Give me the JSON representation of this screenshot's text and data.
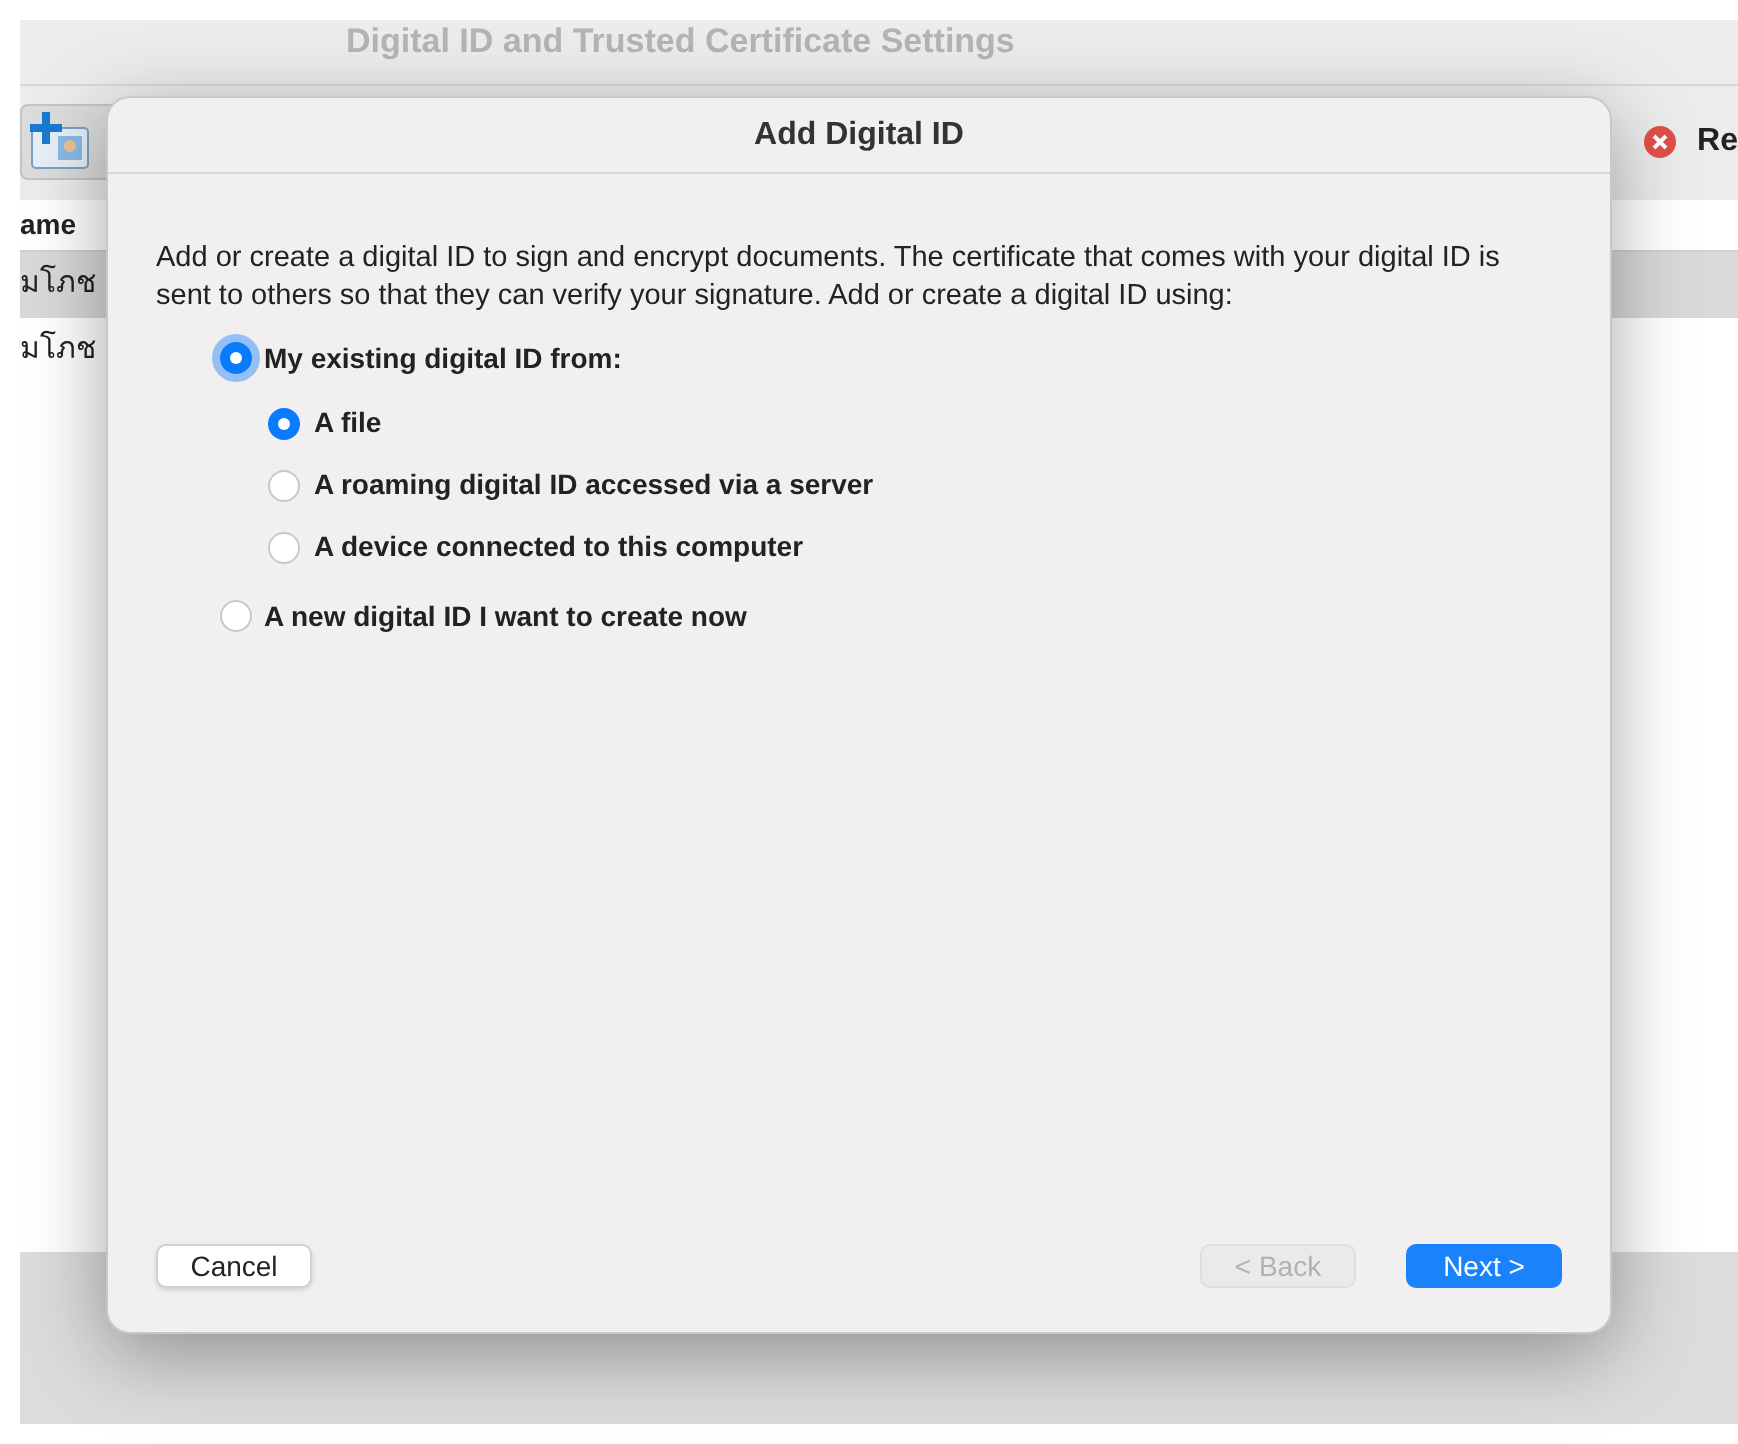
{
  "background_window": {
    "title": "Digital ID and Trusted Certificate Settings",
    "toolbar_label": "Re",
    "column_header": "ame",
    "rows": [
      {
        "name": "มโภช",
        "selected": true
      },
      {
        "name": "มโภช",
        "selected": false
      }
    ]
  },
  "dialog": {
    "title": "Add Digital ID",
    "intro": "Add or create a digital ID to sign and encrypt documents. The certificate that comes with your digital ID is sent to others so that they can verify your signature. Add or create a digital ID using:",
    "options": [
      {
        "label": "My existing digital ID from:",
        "selected": true,
        "children": [
          {
            "label": "A file",
            "selected": true
          },
          {
            "label": "A roaming digital ID accessed via a server",
            "selected": false
          },
          {
            "label": "A device connected to this computer",
            "selected": false
          }
        ]
      },
      {
        "label": "A new digital ID I want to create now",
        "selected": false
      }
    ],
    "buttons": [
      {
        "label": "Cancel",
        "kind": "plain",
        "disabled": false
      },
      {
        "label": "< Back",
        "kind": "plain",
        "disabled": true
      },
      {
        "label": "Next >",
        "kind": "primary",
        "disabled": false
      }
    ]
  }
}
